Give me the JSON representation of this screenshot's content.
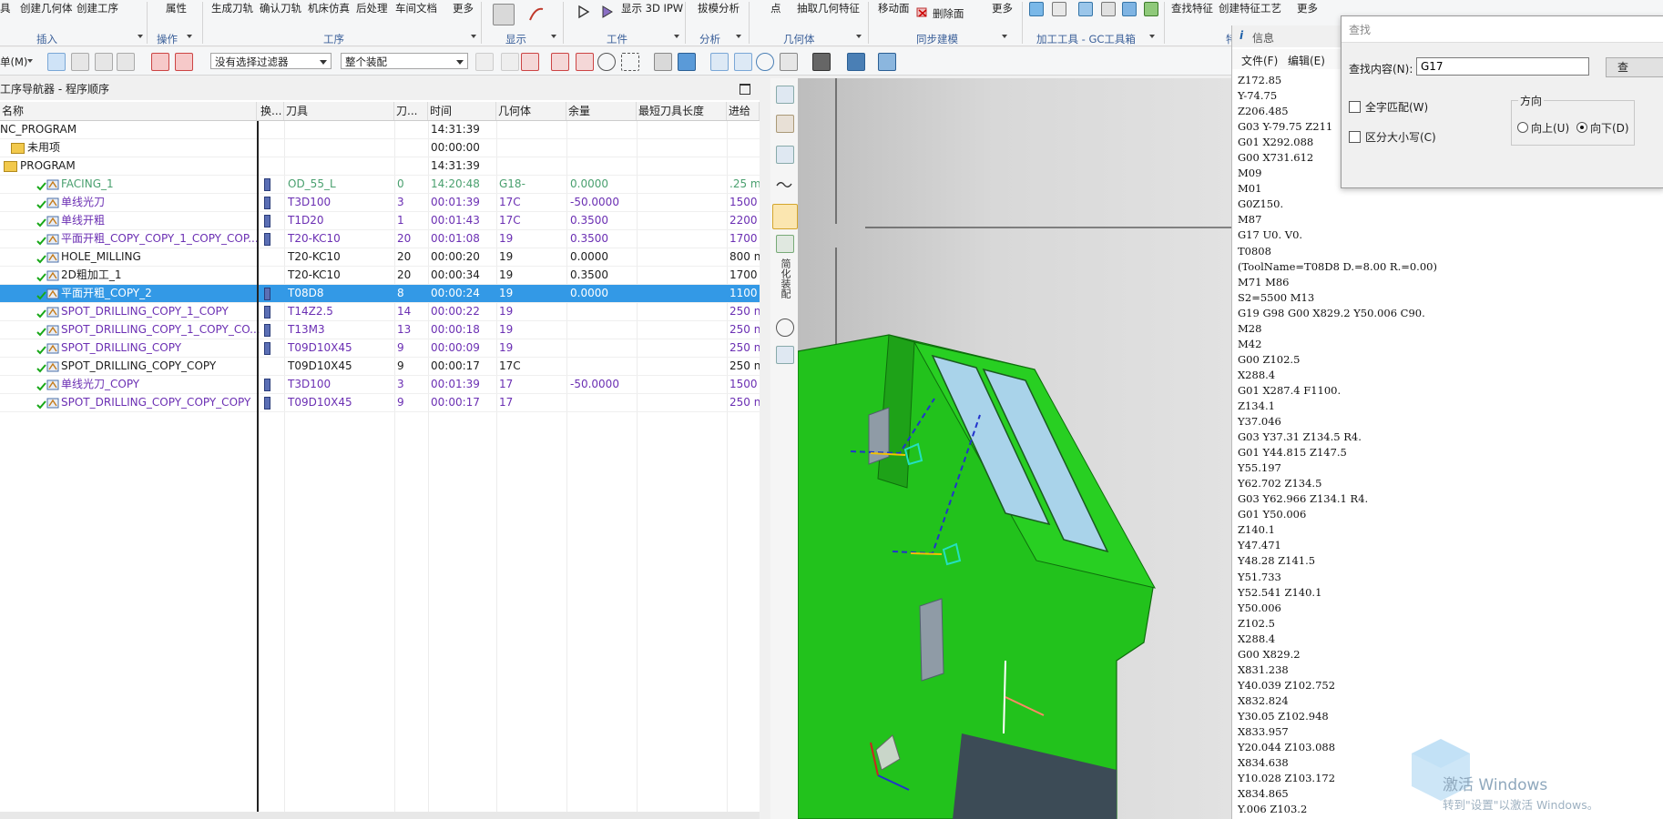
{
  "ribbon": {
    "items": [
      "具",
      "创建几何体",
      "创建工序",
      "属性",
      "生成刀轨",
      "确认刀轨",
      "机床仿真",
      "后处理",
      "车间文档",
      "更多",
      "显示 3D IPW",
      "拔模分析",
      "点",
      "抽取几何特征",
      "移动面",
      "删除面",
      "更多",
      "查找特征",
      "创建特征工艺",
      "更多"
    ],
    "groups": [
      "插入",
      "操作",
      "工序",
      "显示",
      "工件",
      "分析",
      "几何体",
      "同步建模",
      "加工工具 - GC工具箱",
      "特"
    ]
  },
  "toolbar": {
    "menu_label": "单(M)",
    "filter_value": "没有选择过滤器",
    "assembly_value": "整个装配"
  },
  "navigator": {
    "title": "工序导航器 - 程序顺序",
    "columns": [
      "名称",
      "换...",
      "刀具",
      "刀...",
      "时间",
      "几何体",
      "余量",
      "最短刀具长度",
      "进给"
    ],
    "rows": [
      {
        "name": "NC_PROGRAM",
        "tool": "",
        "tnum": "",
        "time": "14:31:39",
        "geo": "",
        "stock": "",
        "feed": ""
      },
      {
        "name": "未用项",
        "tool": "",
        "tnum": "",
        "time": "00:00:00",
        "geo": "",
        "stock": "",
        "feed": ""
      },
      {
        "name": "PROGRAM",
        "tool": "",
        "tnum": "",
        "time": "14:31:39",
        "geo": "",
        "stock": "",
        "feed": ""
      },
      {
        "name": "FACING_1",
        "tool": "OD_55_L",
        "tnum": "0",
        "time": "14:20:48",
        "geo": "G18-",
        "stock": "0.0000",
        "feed": ".25 m"
      },
      {
        "name": "单线光刀",
        "tool": "T3D100",
        "tnum": "3",
        "time": "00:01:39",
        "geo": "17C",
        "stock": "-50.0000",
        "feed": "1500"
      },
      {
        "name": "单线开粗",
        "tool": "T1D20",
        "tnum": "1",
        "time": "00:01:43",
        "geo": "17C",
        "stock": "0.3500",
        "feed": "2200"
      },
      {
        "name": "平面开粗_COPY_COPY_1_COPY_COP...",
        "tool": "T20-KC10",
        "tnum": "20",
        "time": "00:01:08",
        "geo": "19",
        "stock": "0.3500",
        "feed": "1700"
      },
      {
        "name": "HOLE_MILLING",
        "tool": "T20-KC10",
        "tnum": "20",
        "time": "00:00:20",
        "geo": "19",
        "stock": "0.0000",
        "feed": "800 n"
      },
      {
        "name": "2D粗加工_1",
        "tool": "T20-KC10",
        "tnum": "20",
        "time": "00:00:34",
        "geo": "19",
        "stock": "0.3500",
        "feed": "1700"
      },
      {
        "name": "平面开粗_COPY_2",
        "tool": "T08D8",
        "tnum": "8",
        "time": "00:00:24",
        "geo": "19",
        "stock": "0.0000",
        "feed": "1100"
      },
      {
        "name": "SPOT_DRILLING_COPY_1_COPY",
        "tool": "T14Z2.5",
        "tnum": "14",
        "time": "00:00:22",
        "geo": "19",
        "stock": "",
        "feed": "250 n"
      },
      {
        "name": "SPOT_DRILLING_COPY_1_COPY_CO...",
        "tool": "T13M3",
        "tnum": "13",
        "time": "00:00:18",
        "geo": "19",
        "stock": "",
        "feed": "250 n"
      },
      {
        "name": "SPOT_DRILLING_COPY",
        "tool": "T09D10X45",
        "tnum": "9",
        "time": "00:00:09",
        "geo": "19",
        "stock": "",
        "feed": "250 n"
      },
      {
        "name": "SPOT_DRILLING_COPY_COPY",
        "tool": "T09D10X45",
        "tnum": "9",
        "time": "00:00:17",
        "geo": "17C",
        "stock": "",
        "feed": "250 n"
      },
      {
        "name": "单线光刀_COPY",
        "tool": "T3D100",
        "tnum": "3",
        "time": "00:01:39",
        "geo": "17",
        "stock": "-50.0000",
        "feed": "1500"
      },
      {
        "name": "SPOT_DRILLING_COPY_COPY_COPY",
        "tool": "T09D10X45",
        "tnum": "9",
        "time": "00:00:17",
        "geo": "17",
        "stock": "",
        "feed": "250 n"
      }
    ]
  },
  "resource_bar": {
    "vertical_label": "简化装配"
  },
  "info": {
    "title": "信息",
    "menu": [
      "文件(F)",
      "编辑(E)"
    ],
    "code": [
      "Z172.85",
      "Y-74.75",
      "Z206.485",
      "G03 Y-79.75 Z211",
      "G01 X292.088",
      "G00 X731.612",
      "M09",
      "M01",
      "G0Z150.",
      "M87",
      "G17 U0. V0.",
      "T0808",
      "(ToolName=T08D8 D.=8.00 R.=0.00)",
      "M71 M86",
      "S2=5500 M13",
      "G19 G98 G00 X829.2 Y50.006 C90.",
      "M28",
      "M42",
      "G00 Z102.5",
      "X288.4",
      "G01 X287.4 F1100.",
      "Z134.1",
      "Y37.046",
      "G03 Y37.31 Z134.5 R4.",
      "G01 Y44.815 Z147.5",
      "Y55.197",
      "Y62.702 Z134.5",
      "G03 Y62.966 Z134.1 R4.",
      "G01 Y50.006",
      "Z140.1",
      "Y47.471",
      "Y48.28 Z141.5",
      "Y51.733",
      "Y52.541 Z140.1",
      "Y50.006",
      "Z102.5",
      "X288.4",
      "G00 X829.2",
      "X831.238",
      "Y40.039 Z102.752",
      "X832.824",
      "Y30.05 Z102.948",
      "X833.957",
      "Y20.044 Z103.088",
      "X834.638",
      "Y10.028 Z103.172",
      "X834.865",
      "Y.006 Z103.2"
    ]
  },
  "find": {
    "title": "查找",
    "label": "查找内容(N):",
    "value": "G17",
    "whole_word": "全字匹配(W)",
    "match_case": "区分大小写(C)",
    "direction": "方向",
    "up": "向上(U)",
    "down": "向下(D)",
    "find_button": "查"
  },
  "watermark": {
    "line1": "激活 Windows",
    "line2": "转到\"设置\"以激活 Windows。"
  },
  "colors": {
    "selection": "#3399e6",
    "purple_text": "#6b2fb3",
    "part_green": "#22c21c",
    "glass": "#a9d3ea"
  }
}
